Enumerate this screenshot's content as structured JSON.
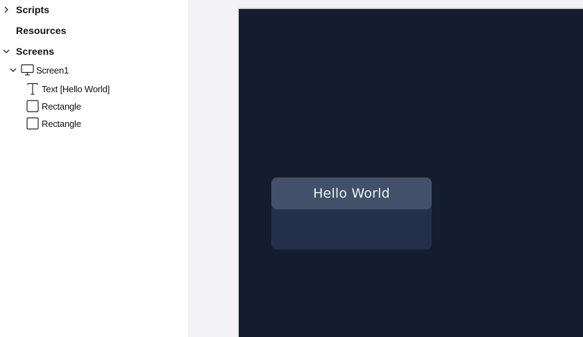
{
  "tree": {
    "scripts_label": "Scripts",
    "resources_label": "Resources",
    "screens_label": "Screens",
    "screen1_label": "Screen1",
    "children": [
      {
        "label": "Text [Hello World]",
        "icon": "text-icon"
      },
      {
        "label": "Rectangle",
        "icon": "rectangle-icon"
      },
      {
        "label": "Rectangle",
        "icon": "rectangle-icon"
      }
    ]
  },
  "canvas": {
    "text": "Hello World",
    "screen_color": "#141d2d",
    "card_color": "#24304a",
    "header_color": "#435069"
  }
}
